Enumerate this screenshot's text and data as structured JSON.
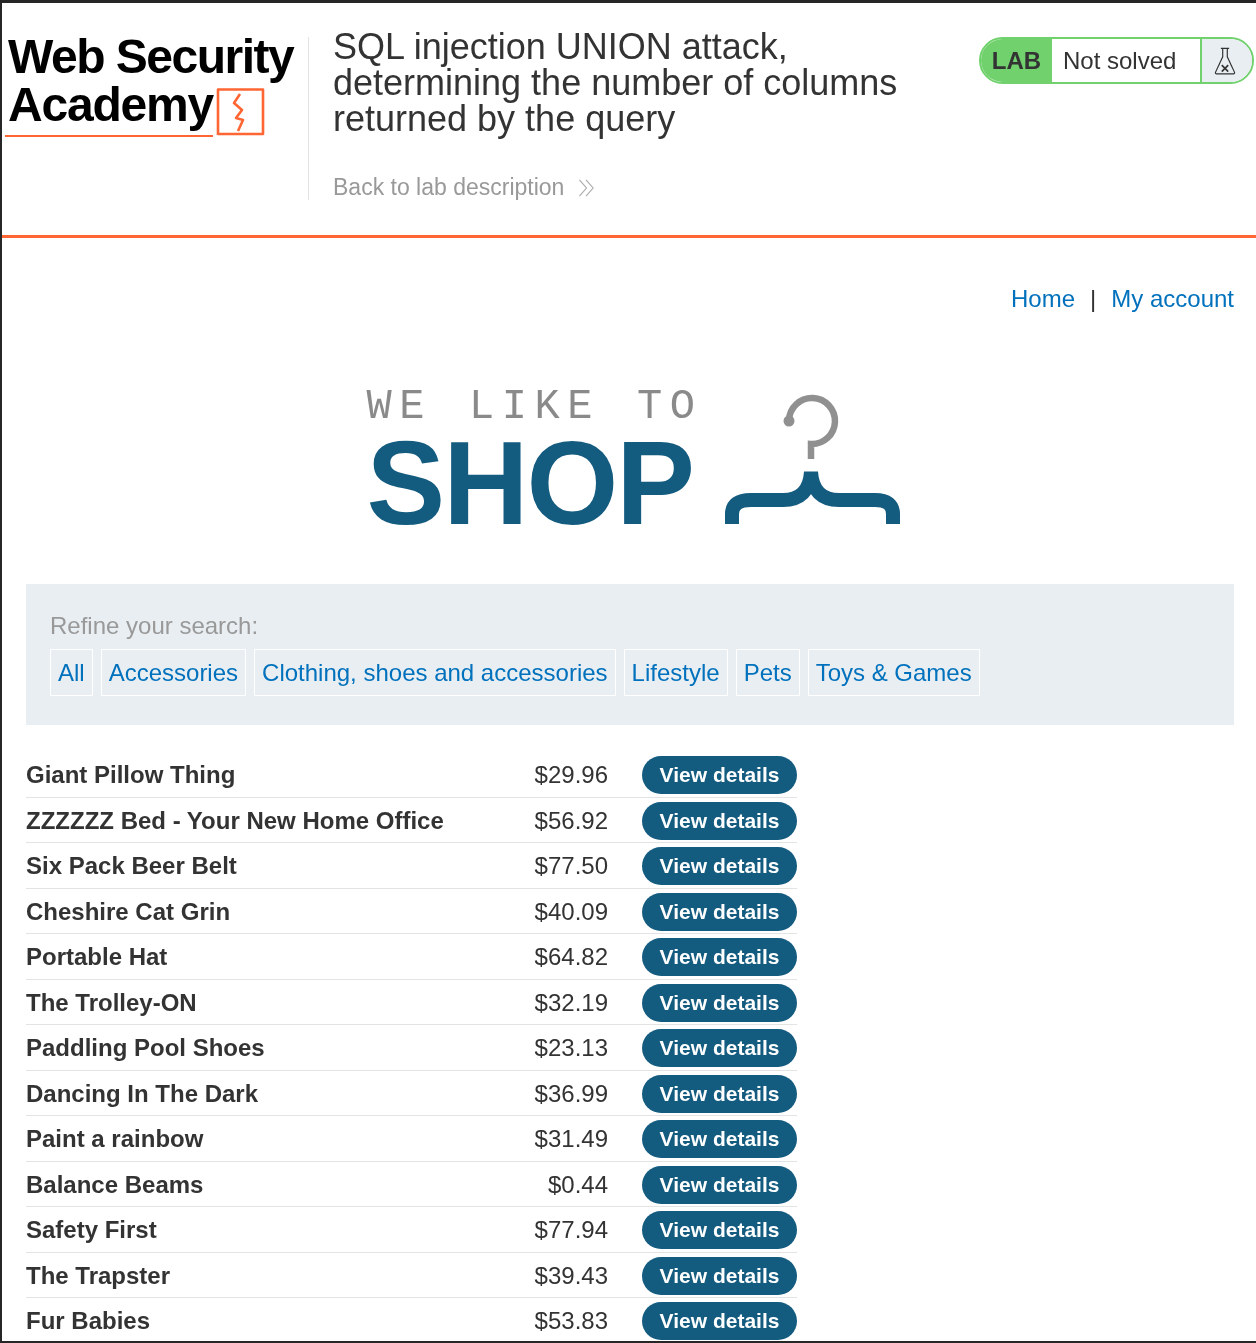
{
  "header": {
    "logo": {
      "line_1": "Web Security",
      "line_2": "Academy"
    },
    "title": "SQL injection UNION attack, determining the number of columns returned by the query",
    "back_link": "Back to lab description",
    "lab_status": {
      "label": "LAB",
      "status": "Not solved",
      "solved": false
    }
  },
  "nav": {
    "links": [
      "Home",
      "My account"
    ],
    "separator": "|"
  },
  "banner": {
    "tagline": "WE LIKE TO",
    "headline": "SHOP"
  },
  "filters": {
    "label": "Refine your search:",
    "categories": [
      "All",
      "Accessories",
      "Clothing, shoes and accessories",
      "Lifestyle",
      "Pets",
      "Toys & Games"
    ]
  },
  "products": [
    {
      "name": "Giant Pillow Thing",
      "price": "$29.96",
      "action": "View details"
    },
    {
      "name": "ZZZZZZ Bed - Your New Home Office",
      "price": "$56.92",
      "action": "View details"
    },
    {
      "name": "Six Pack Beer Belt",
      "price": "$77.50",
      "action": "View details"
    },
    {
      "name": "Cheshire Cat Grin",
      "price": "$40.09",
      "action": "View details"
    },
    {
      "name": "Portable Hat",
      "price": "$64.82",
      "action": "View details"
    },
    {
      "name": "The Trolley-ON",
      "price": "$32.19",
      "action": "View details"
    },
    {
      "name": "Paddling Pool Shoes",
      "price": "$23.13",
      "action": "View details"
    },
    {
      "name": "Dancing In The Dark",
      "price": "$36.99",
      "action": "View details"
    },
    {
      "name": "Paint a rainbow",
      "price": "$31.49",
      "action": "View details"
    },
    {
      "name": "Balance Beams",
      "price": "$0.44",
      "action": "View details"
    },
    {
      "name": "Safety First",
      "price": "$77.94",
      "action": "View details"
    },
    {
      "name": "The Trapster",
      "price": "$39.43",
      "action": "View details"
    },
    {
      "name": "Fur Babies",
      "price": "$53.83",
      "action": "View details"
    }
  ]
}
